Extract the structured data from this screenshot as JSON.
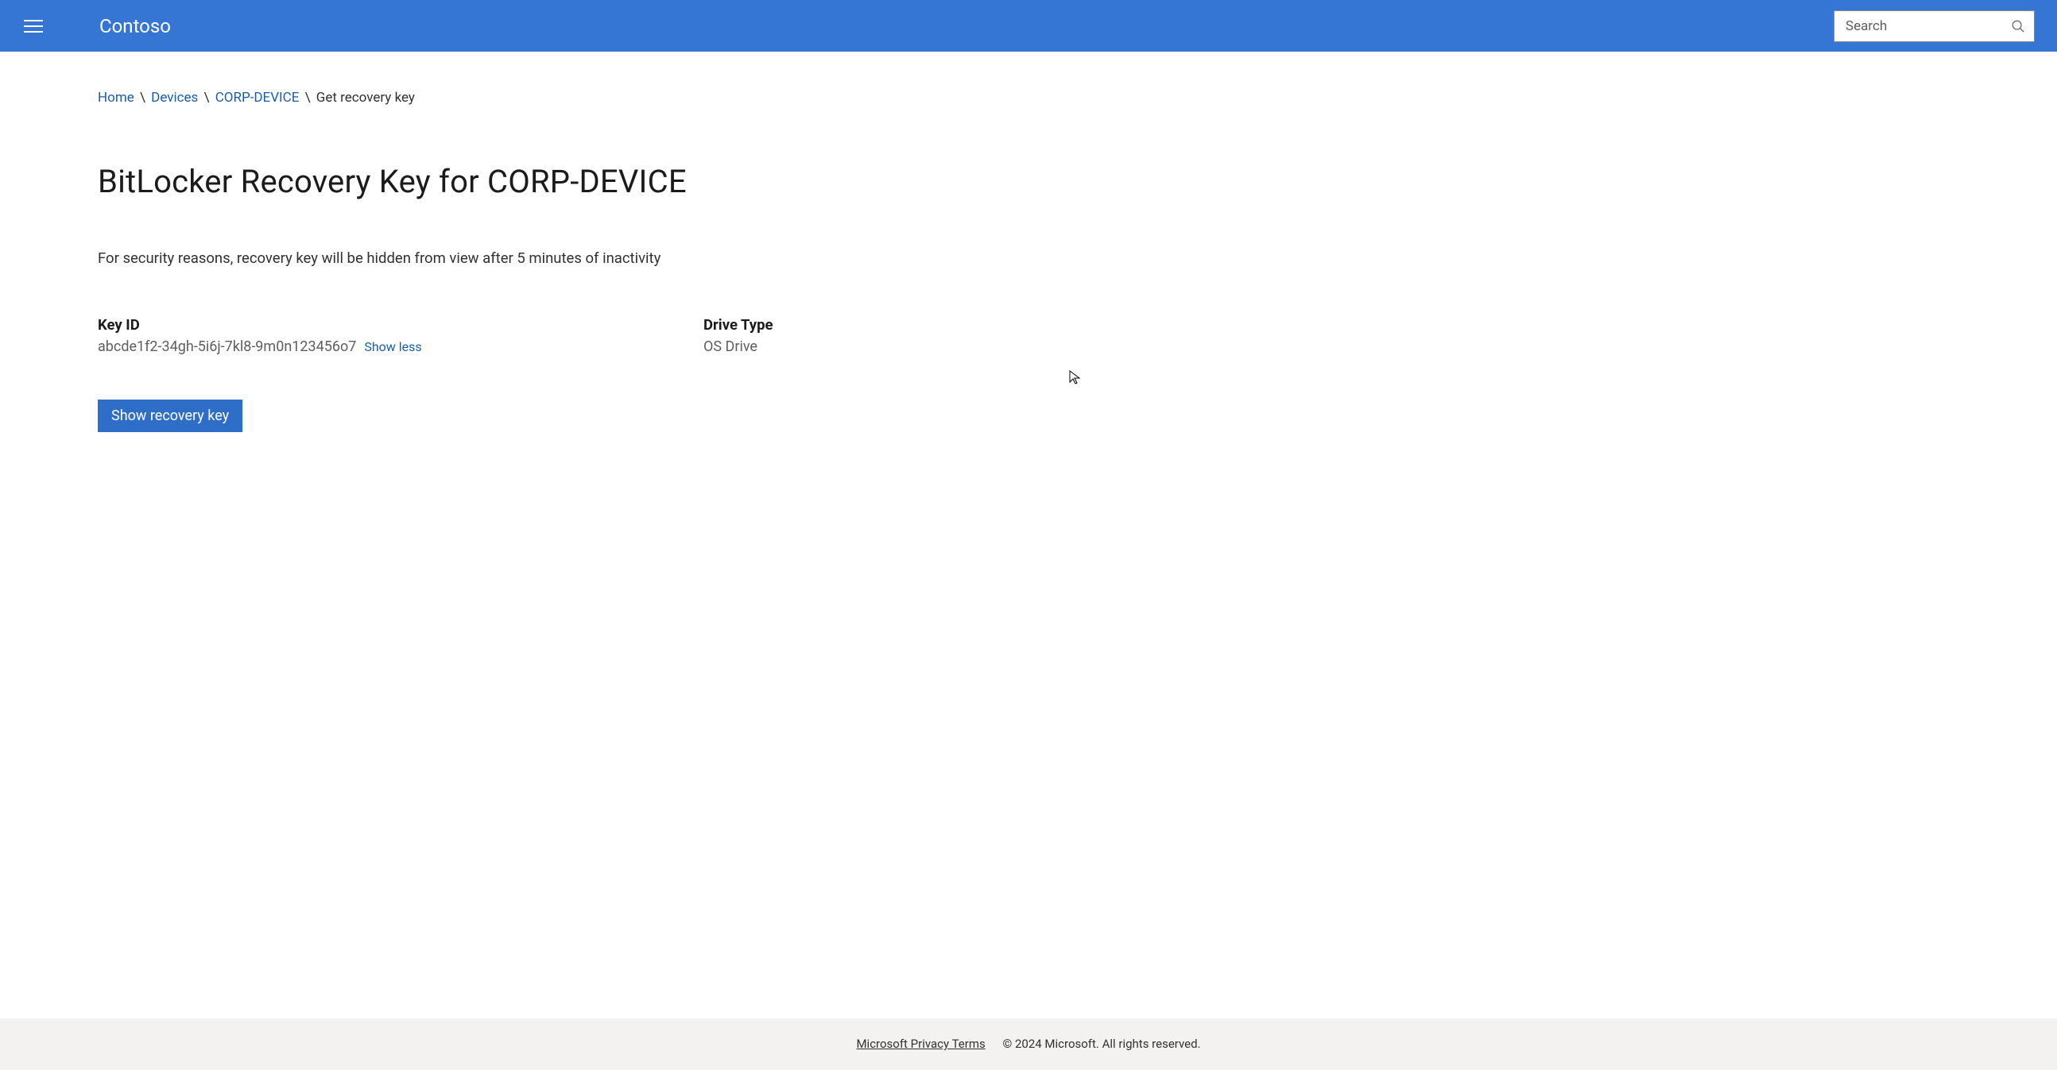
{
  "header": {
    "brand": "Contoso",
    "search_placeholder": "Search"
  },
  "breadcrumb": {
    "items": [
      {
        "label": "Home",
        "link": true
      },
      {
        "label": "Devices",
        "link": true
      },
      {
        "label": "CORP-DEVICE",
        "link": true
      },
      {
        "label": "Get recovery key",
        "link": false
      }
    ]
  },
  "page": {
    "title": "BitLocker Recovery Key for CORP-DEVICE",
    "notice": "For security reasons, recovery key will be hidden from view after 5 minutes of inactivity"
  },
  "keyInfo": {
    "key_id_label": "Key ID",
    "key_id_value": "abcde1f2-34gh-5i6j-7kl8-9m0n123456o7",
    "show_less": "Show less",
    "drive_type_label": "Drive Type",
    "drive_type_value": "OS Drive"
  },
  "actions": {
    "show_recovery_key": "Show recovery key"
  },
  "footer": {
    "privacy_link": "Microsoft Privacy Terms",
    "copyright": "© 2024 Microsoft. All rights reserved."
  }
}
